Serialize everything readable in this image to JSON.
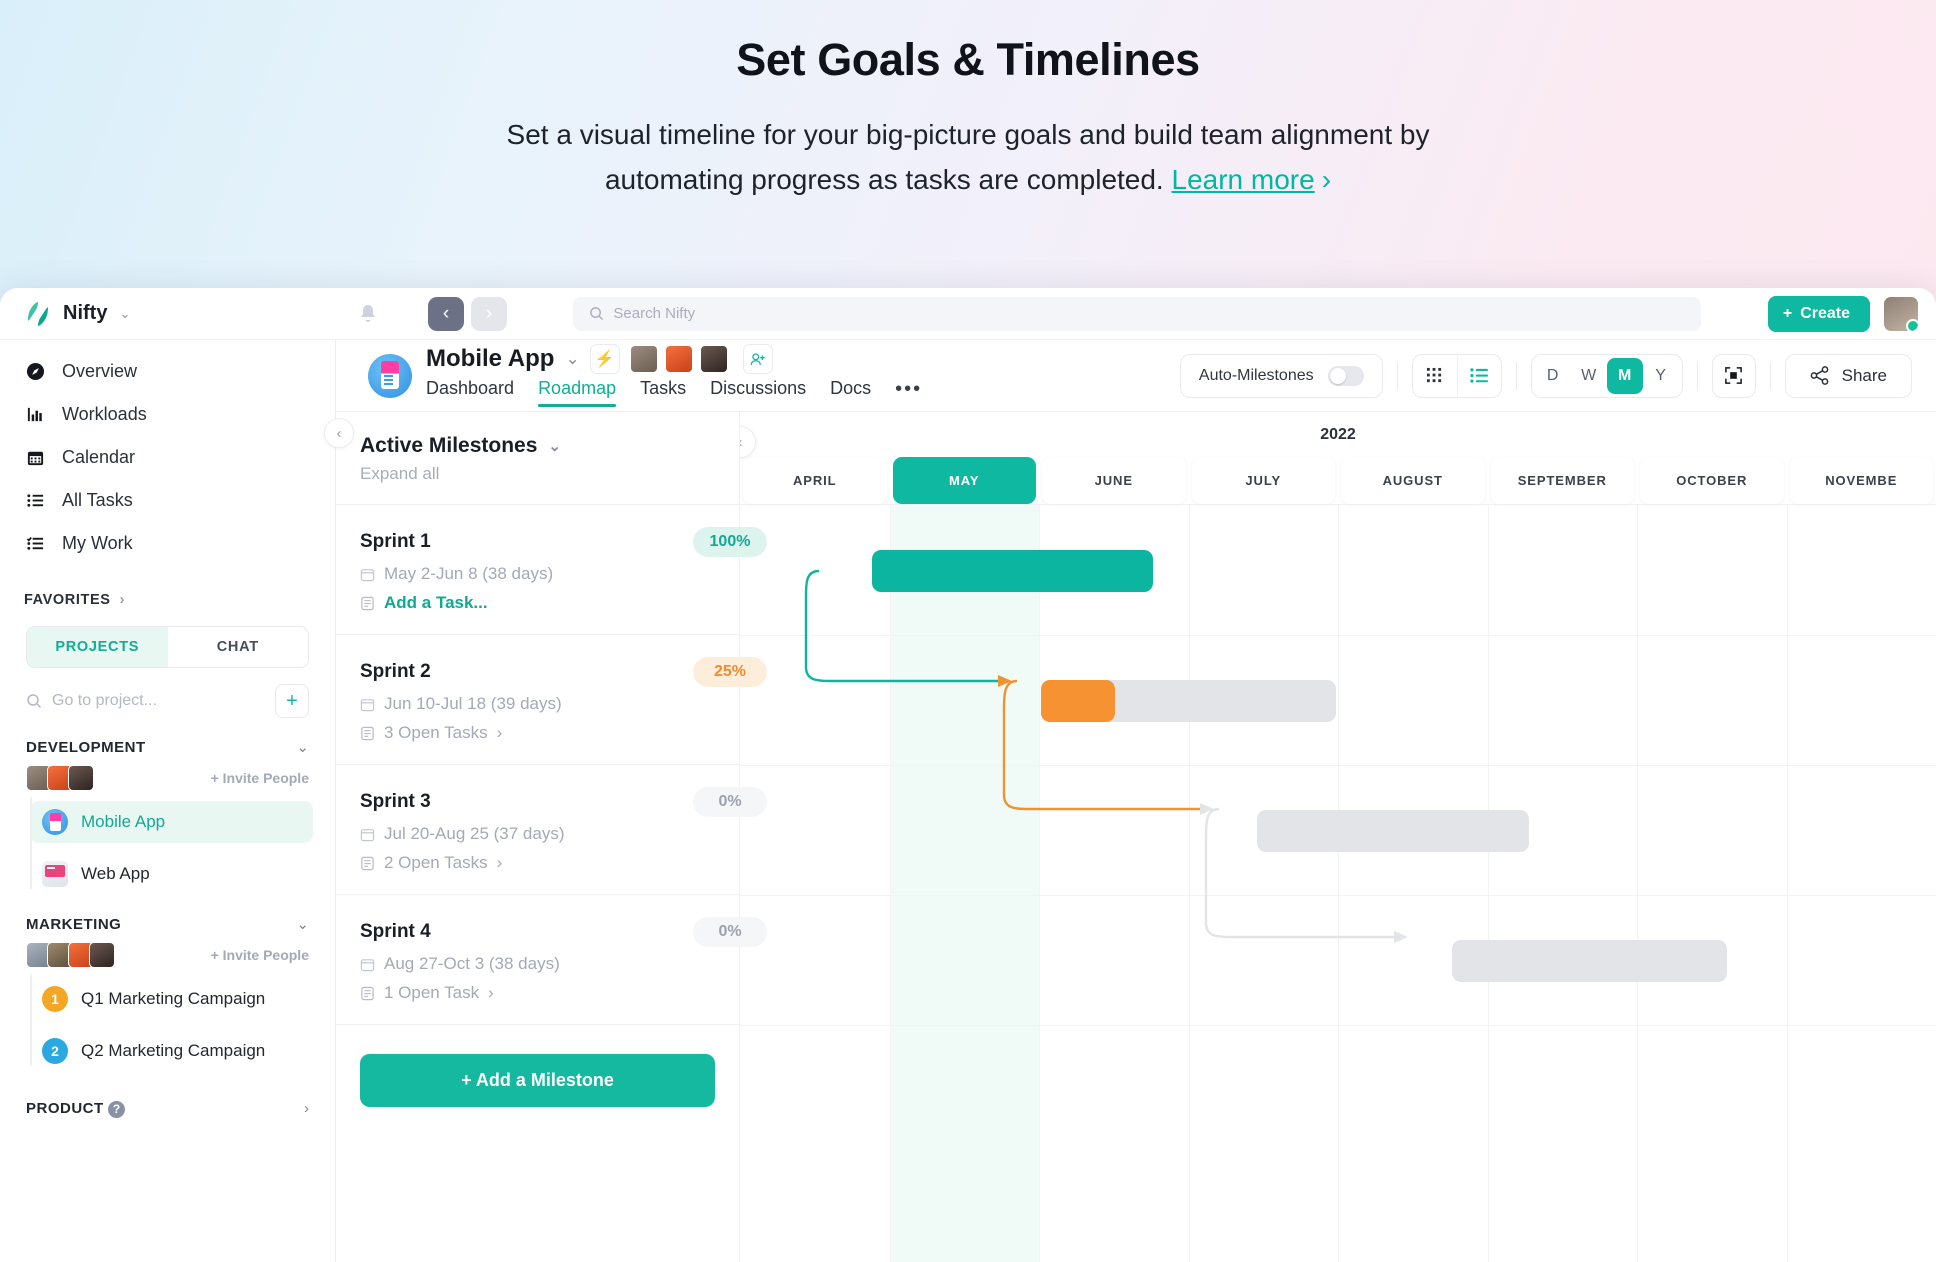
{
  "hero": {
    "title": "Set Goals & Timelines",
    "subtitle_line1": "Set a visual timeline for your big-picture goals and build team alignment by",
    "subtitle_line2": "automating progress as tasks are completed.",
    "link": "Learn more",
    "link_chevron": "›"
  },
  "topbar": {
    "brand": "Nifty",
    "brand_caret": "⌄",
    "bell_icon": "bell-icon",
    "back_icon": "‹",
    "forward_icon": "›",
    "search_placeholder": "Search Nifty",
    "create_label": "Create",
    "create_plus": "+"
  },
  "sidebar": {
    "nav": [
      {
        "label": "Overview",
        "icon": "compass-icon"
      },
      {
        "label": "Workloads",
        "icon": "bar-chart-icon"
      },
      {
        "label": "Calendar",
        "icon": "calendar-icon"
      },
      {
        "label": "All Tasks",
        "icon": "list-icon"
      },
      {
        "label": "My Work",
        "icon": "checklist-icon"
      }
    ],
    "favorites": {
      "label": "FAVORITES",
      "arrow": "›"
    },
    "tabs": {
      "projects": "PROJECTS",
      "chat": "CHAT"
    },
    "project_search_placeholder": "Go to project...",
    "add_project": "+",
    "groups": [
      {
        "name": "DEVELOPMENT",
        "chevron": "⌄",
        "invite": "+ Invite People",
        "members": [
          "#8d7f72",
          "#e05a2b",
          "#4a3a33"
        ],
        "projects": [
          {
            "label": "Mobile App",
            "type": "icon",
            "active": true
          },
          {
            "label": "Web App",
            "type": "icon",
            "active": false
          }
        ]
      },
      {
        "name": "MARKETING",
        "chevron": "⌄",
        "invite": "+ Invite People",
        "members": [
          "#9aa4b0",
          "#7a6b58",
          "#e05a2b",
          "#4a3a33"
        ],
        "projects": [
          {
            "label": "Q1 Marketing Campaign",
            "type": "number",
            "number": "1",
            "color": "#f5a623",
            "active": false
          },
          {
            "label": "Q2 Marketing Campaign",
            "type": "number",
            "number": "2",
            "color": "#2aa9e0",
            "active": false
          }
        ]
      }
    ],
    "product": {
      "label": "PRODUCT",
      "help": "?",
      "arrow": "›"
    },
    "collapse_icon": "‹"
  },
  "project": {
    "title": "Mobile App",
    "title_caret": "⌄",
    "bolt_icon": "⚡",
    "add_person_icon": "person-plus-icon",
    "members": [
      "#8d7f72",
      "#e05a2b",
      "#4a3a33"
    ],
    "tabs": [
      {
        "label": "Dashboard",
        "active": false
      },
      {
        "label": "Roadmap",
        "active": true
      },
      {
        "label": "Tasks",
        "active": false
      },
      {
        "label": "Discussions",
        "active": false
      },
      {
        "label": "Docs",
        "active": false
      }
    ],
    "more": "•••"
  },
  "toolbar": {
    "auto_milestones": "Auto-Milestones",
    "auto_milestones_on": false,
    "view_grid_icon": "grid-view-icon",
    "view_list_icon": "list-view-icon",
    "zoom_levels": [
      {
        "label": "D",
        "active": false
      },
      {
        "label": "W",
        "active": false
      },
      {
        "label": "M",
        "active": true
      },
      {
        "label": "Y",
        "active": false
      }
    ],
    "fullscreen_icon": "fullscreen-icon",
    "share_label": "Share",
    "share_icon": "share-icon"
  },
  "milestones_panel": {
    "heading": "Active Milestones",
    "heading_caret": "⌄",
    "expand_all": "Expand all",
    "calendar_icon": "calendar-small-icon",
    "task_icon": "task-small-icon",
    "chevron": "›",
    "add_milestone": "+ Add a Milestone",
    "rows": [
      {
        "name": "Sprint 1",
        "dates": "May 2-Jun 8 (38 days)",
        "tasks": "Add a Task...",
        "tasks_style": "add",
        "progress": "100%",
        "badge": "g"
      },
      {
        "name": "Sprint 2",
        "dates": "Jun 10-Jul 18 (39 days)",
        "tasks": "3 Open Tasks",
        "tasks_style": "open",
        "progress": "25%",
        "badge": "o"
      },
      {
        "name": "Sprint 3",
        "dates": "Jul 20-Aug 25 (37 days)",
        "tasks": "2 Open Tasks",
        "tasks_style": "open",
        "progress": "0%",
        "badge": "n"
      },
      {
        "name": "Sprint 4",
        "dates": "Aug 27-Oct 3 (38 days)",
        "tasks": "1 Open Task",
        "tasks_style": "open",
        "progress": "0%",
        "badge": "n"
      }
    ]
  },
  "timeline": {
    "year": "2022",
    "collapse_icon": "‹",
    "months": [
      {
        "label": "APRIL",
        "active": false
      },
      {
        "label": "MAY",
        "active": true
      },
      {
        "label": "JUNE",
        "active": false
      },
      {
        "label": "JULY",
        "active": false
      },
      {
        "label": "AUGUST",
        "active": false
      },
      {
        "label": "SEPTEMBER",
        "active": false
      },
      {
        "label": "OCTOBER",
        "active": false
      },
      {
        "label": "NOVEMBE",
        "active": false
      }
    ]
  },
  "chart_data": {
    "type": "bar",
    "title": "Mobile App Roadmap — Active Milestones",
    "xlabel": "2022",
    "ylabel": "",
    "axis_unit": "month",
    "x_axis_categories": [
      "APRIL",
      "MAY",
      "JUNE",
      "JULY",
      "AUGUST",
      "SEPTEMBER",
      "OCTOBER",
      "NOVEMBER"
    ],
    "highlight_column": "MAY",
    "grid": true,
    "legend": "none",
    "series": [
      {
        "name": "Sprint 1",
        "start": "May 2",
        "end": "Jun 8",
        "duration_days": 38,
        "progress_pct": 100,
        "color": "#0bb5a0",
        "state": "complete",
        "bar_left_pct": 12.1,
        "bar_width_pct": 24.0
      },
      {
        "name": "Sprint 2",
        "start": "Jun 10",
        "end": "Jul 18",
        "duration_days": 39,
        "progress_pct": 25,
        "color": "#f79232",
        "track_color": "#e3e4e7",
        "state": "in-progress",
        "bar_left_pct": 26.5,
        "bar_width_pct": 24.6
      },
      {
        "name": "Sprint 3",
        "start": "Jul 20",
        "end": "Aug 25",
        "duration_days": 37,
        "progress_pct": 0,
        "color": "#e3e4e7",
        "state": "not-started",
        "bar_left_pct": 44.4,
        "bar_width_pct": 23.3
      },
      {
        "name": "Sprint 4",
        "start": "Aug 27",
        "end": "Oct 3",
        "duration_days": 38,
        "progress_pct": 0,
        "color": "#e3e4e7",
        "state": "not-started",
        "bar_left_pct": 58.3,
        "bar_width_pct": 23.6
      }
    ],
    "dependencies": [
      {
        "from": "Sprint 1",
        "to": "Sprint 2",
        "color": "#0bb5a0"
      },
      {
        "from": "Sprint 2",
        "to": "Sprint 3",
        "color": "#f79232"
      },
      {
        "from": "Sprint 3",
        "to": "Sprint 4",
        "color": "#e3e4e7"
      }
    ]
  }
}
